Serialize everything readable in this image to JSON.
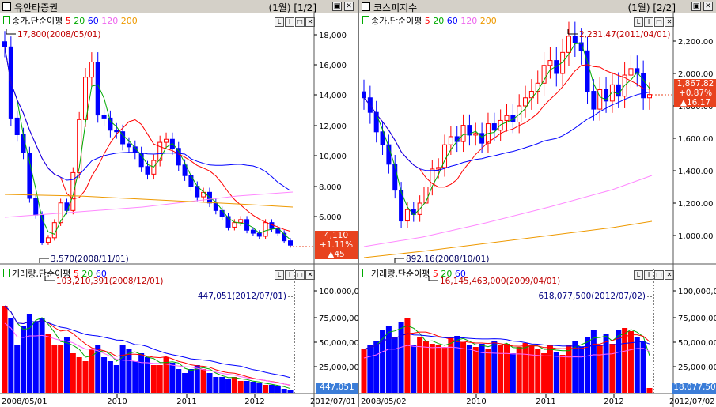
{
  "left": {
    "title": "유안타증권",
    "period": "(1월) [1/2]",
    "price_legend": {
      "label": "종가,단순이평",
      "ma": [
        "5",
        "20",
        "60",
        "120",
        "200"
      ],
      "colors": [
        "#ff0000",
        "#00aa00",
        "#0000ff",
        "#ff66ff",
        "#ee9900"
      ]
    },
    "volume_legend": {
      "label": "거래량,단순이평",
      "ma": [
        "5",
        "20",
        "60"
      ],
      "colors": [
        "#ff0000",
        "#00aa00",
        "#0000ff"
      ]
    },
    "price_axis": [
      "18,000",
      "16,000",
      "14,000",
      "12,000",
      "10,000",
      "8,000",
      "6,000"
    ],
    "volume_axis": [
      "100,000,00",
      "75,000,000",
      "50,000,000",
      "25,000,000"
    ],
    "date_axis": [
      "2008/05/01",
      "2010",
      "2011",
      "2012",
      "2012/07/01"
    ],
    "high_ann": "17,800(2008/05/01)",
    "low_ann": "3,570(2008/11/01)",
    "vol_high_ann": "103,210,391(2008/12/01)",
    "vol_last_ann": "447,051(2012/07/01)",
    "current": {
      "price": "4,110",
      "change_pct": "+1.11%",
      "change": "▲45"
    },
    "current_volume": "447,051"
  },
  "right": {
    "title": "코스피지수",
    "period": "(1월) [2/2]",
    "price_legend": {
      "label": "종가,단순이평",
      "ma": [
        "5",
        "20",
        "60",
        "120",
        "200"
      ],
      "colors": [
        "#ff0000",
        "#00aa00",
        "#0000ff",
        "#ff66ff",
        "#ee9900"
      ]
    },
    "volume_legend": {
      "label": "거래량,단순이평",
      "ma": [
        "5",
        "20",
        "60"
      ],
      "colors": [
        "#ff0000",
        "#00aa00",
        "#0000ff"
      ]
    },
    "price_axis": [
      "2,200.00",
      "2,000.00",
      "1,800.00",
      "1,600.00",
      "1,400.00",
      "1,200.00",
      "1,000.00"
    ],
    "volume_axis": [
      "100,000,00",
      "75,000,000",
      "50,000,000",
      "25,000,000"
    ],
    "date_axis": [
      "2008/05/02",
      "2010",
      "2011",
      "2012",
      "2012/07/02"
    ],
    "high_ann": "2,231.47(2011/04/01)",
    "low_ann": "892.16(2008/10/01)",
    "vol_high_ann": "16,145,463,000(2009/04/01)",
    "vol_last_ann": "618,077,500(2012/07/02)",
    "current": {
      "price": "1,867.82",
      "change_pct": "+0.87%",
      "change": "▲16.17"
    },
    "current_volume": "18,077,50"
  },
  "window_buttons": [
    "□",
    "□",
    "✕"
  ],
  "sub_buttons": [
    "L",
    "I",
    "□",
    "✕"
  ]
}
